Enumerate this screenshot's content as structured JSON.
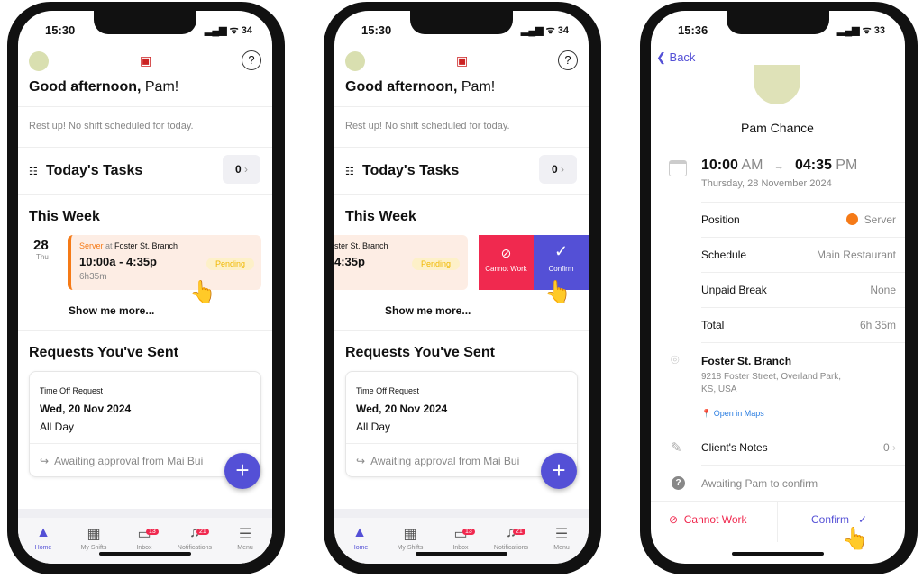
{
  "status": {
    "time1": "15:30",
    "time2": "15:30",
    "time3": "15:36",
    "battery1": "34",
    "battery3": "33"
  },
  "home": {
    "greeting_bold": "Good afternoon,",
    "greeting_name": " Pam!",
    "rest": "Rest up! No shift scheduled for today.",
    "tasks_title": "Today's Tasks",
    "tasks_count": "0",
    "week_title": "This Week",
    "day_num": "28",
    "day_name": "Thu",
    "shift_position": "Server",
    "shift_at": " at ",
    "shift_location": "Foster St. Branch",
    "shift_time": "10:00a - 4:35p",
    "shift_duration": "6h35m",
    "shift_status": "Pending",
    "show_more": "Show me more...",
    "requests_title": "Requests You've Sent",
    "req_type": "Time Off Request",
    "req_date": "Wed, 20 Nov 2024",
    "req_span": "All Day",
    "req_status": "Awaiting approval from Mai Bui",
    "swipe_location": "ster St. Branch",
    "swipe_time": "4:35p",
    "swipe_cannot": "Cannot Work",
    "swipe_confirm": "Confirm"
  },
  "tabs": [
    {
      "label": "Home",
      "icon": "home-icon"
    },
    {
      "label": "My Shifts",
      "icon": "calendar-icon"
    },
    {
      "label": "Inbox",
      "icon": "chat-icon",
      "badge": "13"
    },
    {
      "label": "Notifications",
      "icon": "bell-icon",
      "badge": "21"
    },
    {
      "label": "Menu",
      "icon": "menu-icon"
    }
  ],
  "detail": {
    "back": "Back",
    "name": "Pam Chance",
    "start": "10:00",
    "start_ampm": " AM",
    "end": "04:35",
    "end_ampm": " PM",
    "date": "Thursday, 28 November 2024",
    "rows": [
      {
        "label": "Position",
        "value": "Server"
      },
      {
        "label": "Schedule",
        "value": "Main Restaurant"
      },
      {
        "label": "Unpaid Break",
        "value": "None"
      },
      {
        "label": "Total",
        "value": "6h 35m"
      }
    ],
    "location": "Foster St. Branch",
    "address": "9218 Foster Street, Overland Park, KS, USA",
    "maps": "Open in Maps",
    "notes": "Client's Notes",
    "notes_count": "0",
    "awaiting": "Awaiting Pam to confirm",
    "cannot": "Cannot Work",
    "confirm": "Confirm"
  },
  "colors": {
    "accent": "#5450d6",
    "danger": "#f0294f",
    "server": "#f57a17",
    "pending": "#f0b800"
  }
}
